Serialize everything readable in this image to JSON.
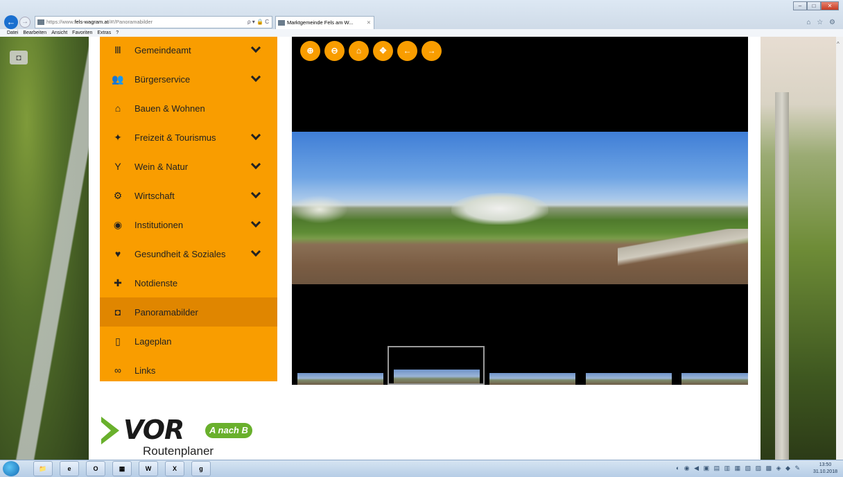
{
  "browser": {
    "url_prefix": "https://www.",
    "url_host": "fels-wagram.at",
    "url_path": "/#!/Panoramabilder",
    "address_tools": "ρ ▾ 🔒 C",
    "tab_title": "Marktgemeinde Fels am W...",
    "tab_close": "✕",
    "back_glyph": "←",
    "forward_glyph": "→",
    "toolbar_icons": "⌂ ☆ ⚙",
    "window_controls": {
      "minimize": "–",
      "maximize": "□",
      "close": "✕"
    },
    "menubar": [
      "Datei",
      "Bearbeiten",
      "Ansicht",
      "Favoriten",
      "Extras",
      "?"
    ]
  },
  "sidebar": {
    "items": [
      {
        "label": "Gemeindeamt",
        "icon": "building-icon",
        "glyph": "Ⅲ",
        "chevron": true,
        "active": false
      },
      {
        "label": "Bürgerservice",
        "icon": "users-icon",
        "glyph": "👥",
        "chevron": true,
        "active": false
      },
      {
        "label": "Bauen & Wohnen",
        "icon": "home-icon",
        "glyph": "⌂",
        "chevron": false,
        "active": false
      },
      {
        "label": "Freizeit & Tourismus",
        "icon": "person-icon",
        "glyph": "✦",
        "chevron": true,
        "active": false
      },
      {
        "label": "Wein & Natur",
        "icon": "glass-icon",
        "glyph": "Y",
        "chevron": true,
        "active": false
      },
      {
        "label": "Wirtschaft",
        "icon": "cogs-icon",
        "glyph": "⚙",
        "chevron": true,
        "active": false
      },
      {
        "label": "Institutionen",
        "icon": "accessibility-icon",
        "glyph": "◉",
        "chevron": true,
        "active": false
      },
      {
        "label": "Gesundheit & Soziales",
        "icon": "heart-icon",
        "glyph": "♥",
        "chevron": true,
        "active": false
      },
      {
        "label": "Notdienste",
        "icon": "medkit-icon",
        "glyph": "✚",
        "chevron": false,
        "active": false
      },
      {
        "label": "Panoramabilder",
        "icon": "camera-icon",
        "glyph": "◘",
        "chevron": false,
        "active": true
      },
      {
        "label": "Lageplan",
        "icon": "map-icon",
        "glyph": "▯",
        "chevron": false,
        "active": false
      },
      {
        "label": "Links",
        "icon": "link-icon",
        "glyph": "∞",
        "chevron": false,
        "active": false
      }
    ]
  },
  "logo": {
    "brand": "VOR",
    "badge": "A nach B",
    "subtitle": "Routenplaner"
  },
  "viewer": {
    "controls": [
      {
        "name": "zoom-in",
        "glyph": "⊕"
      },
      {
        "name": "zoom-out",
        "glyph": "⊖"
      },
      {
        "name": "home",
        "glyph": "⌂"
      },
      {
        "name": "move",
        "glyph": "✥"
      },
      {
        "name": "previous",
        "glyph": "←"
      },
      {
        "name": "next",
        "glyph": "→"
      }
    ],
    "thumbnail_count": 5,
    "selected_thumbnail": 2
  },
  "taskbar": {
    "apps": [
      "📁",
      "e",
      "O",
      "▦",
      "W",
      "X",
      "g"
    ],
    "tray": "◐ ◉ ◀ ▣ ▤ ▥ ▦ ▧ ▨ ▩ ◈ ◆ ✎",
    "time": "13:50",
    "date": "31.10.2018"
  }
}
